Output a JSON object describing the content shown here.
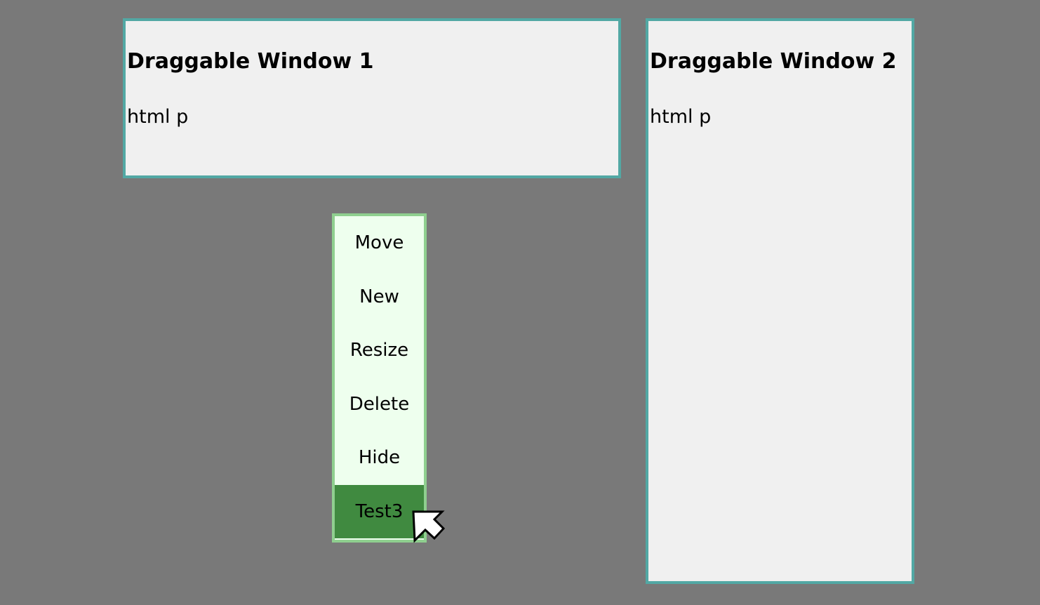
{
  "windows": [
    {
      "title": "Draggable Window 1",
      "body": "html p"
    },
    {
      "title": "Draggable Window 2",
      "body": "html p"
    }
  ],
  "context_menu": {
    "items": [
      {
        "label": "Move"
      },
      {
        "label": "New"
      },
      {
        "label": "Resize"
      },
      {
        "label": "Delete"
      },
      {
        "label": "Hide"
      },
      {
        "label": "Test3"
      }
    ],
    "highlighted": "Test3"
  },
  "colors": {
    "desktop_background": "#797979",
    "window_border": "#52a8a4",
    "window_background": "#f0f0f0",
    "menu_border": "#8fcf8f",
    "menu_background": "#eeffee",
    "menu_highlight": "#408a40"
  },
  "cursor": {
    "icon": "mouse-pointer-icon"
  }
}
